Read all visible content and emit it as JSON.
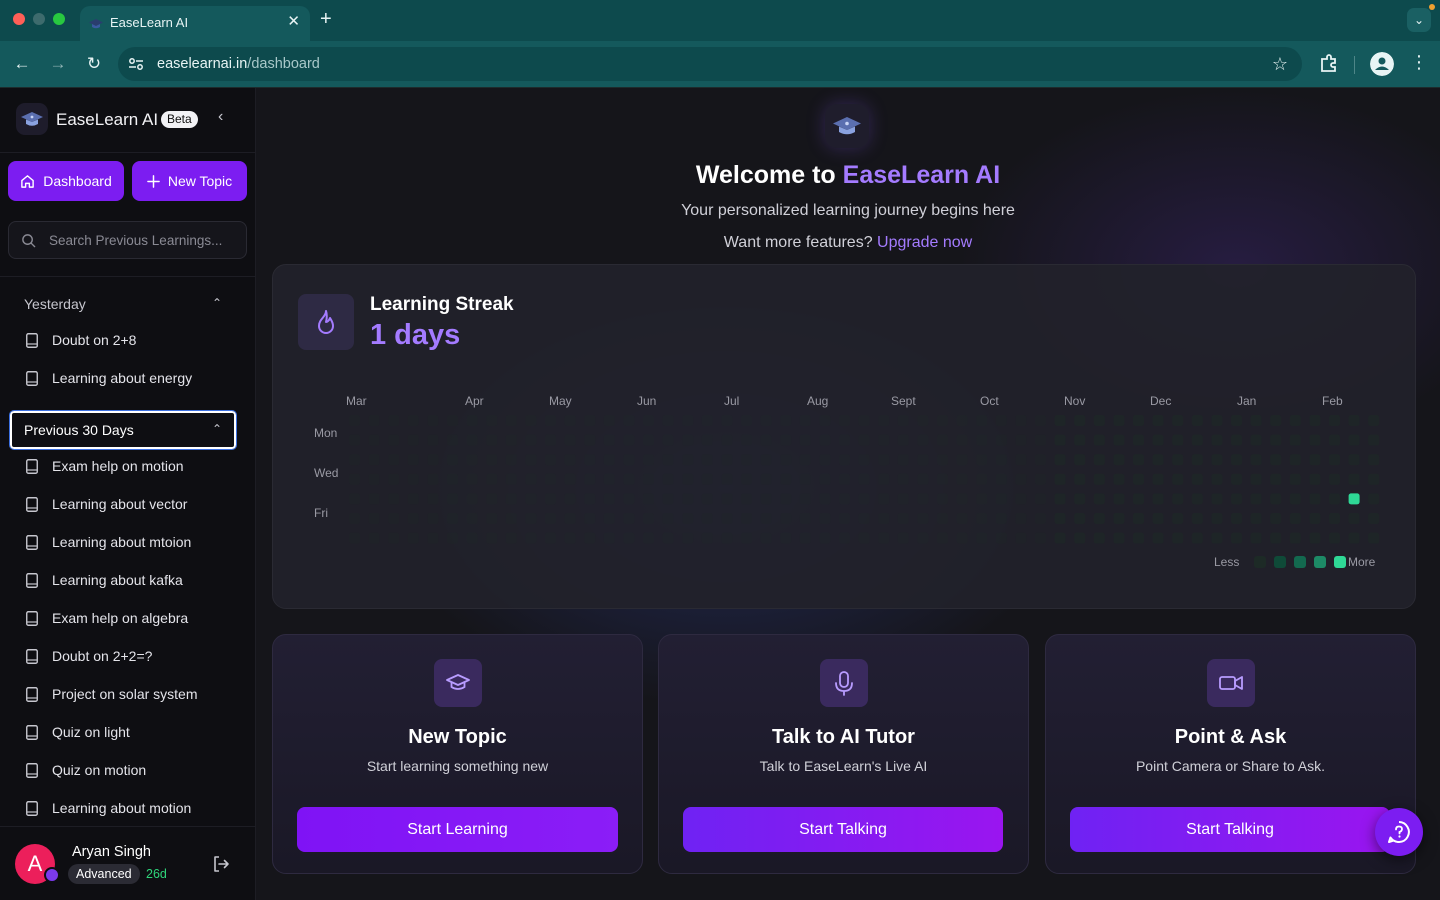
{
  "browser": {
    "tab_title": "EaseLearn AI",
    "url_domain": "easelearnai.in",
    "url_path": "/dashboard"
  },
  "sidebar": {
    "brand": "EaseLearn AI",
    "badge": "Beta",
    "dashboard_label": "Dashboard",
    "new_topic_label": "New Topic",
    "search_placeholder": "Search Previous Learnings...",
    "groups": [
      {
        "label": "Yesterday",
        "items": [
          "Doubt on 2+8",
          "Learning about energy"
        ]
      },
      {
        "label": "Previous 30 Days",
        "items": [
          "Exam help on motion",
          "Learning about vector",
          "Learning about mtoion",
          "Learning about kafka",
          "Exam help on algebra",
          "Doubt on 2+2=?",
          "Project on solar system",
          "Quiz on light",
          "Quiz on motion",
          "Learning about motion"
        ]
      }
    ],
    "user": {
      "initial": "A",
      "name": "Aryan Singh",
      "level": "Advanced",
      "streak": "26d"
    }
  },
  "main": {
    "welcome_prefix": "Welcome to ",
    "welcome_brand": "EaseLearn AI",
    "tagline": "Your personalized learning journey begins here",
    "upgrade_prompt": "Want more features? ",
    "upgrade_link": "Upgrade now",
    "streak": {
      "title": "Learning Streak",
      "value": "1 days",
      "months": [
        "Mar",
        "Apr",
        "May",
        "Jun",
        "Jul",
        "Aug",
        "Sept",
        "Oct",
        "Nov",
        "Dec",
        "Jan",
        "Feb"
      ],
      "day_labels": [
        "Mon",
        "Wed",
        "Fri"
      ],
      "legend_less": "Less",
      "legend_more": "More",
      "legend_colors": [
        "#1d2a26",
        "#0f4a38",
        "#13694f",
        "#1d8a66",
        "#2fd896"
      ],
      "active_day": {
        "month": "Feb",
        "weekday": "Thu",
        "level": 4
      }
    },
    "cards": [
      {
        "title": "New Topic",
        "subtitle": "Start learning something new",
        "button": "Start Learning",
        "icon": "graduation-cap-icon"
      },
      {
        "title": "Talk to AI Tutor",
        "subtitle": "Talk to EaseLearn's Live AI",
        "button": "Start Talking",
        "icon": "microphone-icon"
      },
      {
        "title": "Point & Ask",
        "subtitle": "Point Camera or Share to Ask.",
        "button": "Start Talking",
        "icon": "video-camera-icon"
      }
    ]
  },
  "colors": {
    "accent": "#7c1df1",
    "accent_text": "#a47bff",
    "browser_chrome": "#0d4a4d",
    "streak_green": "#2fd896"
  }
}
